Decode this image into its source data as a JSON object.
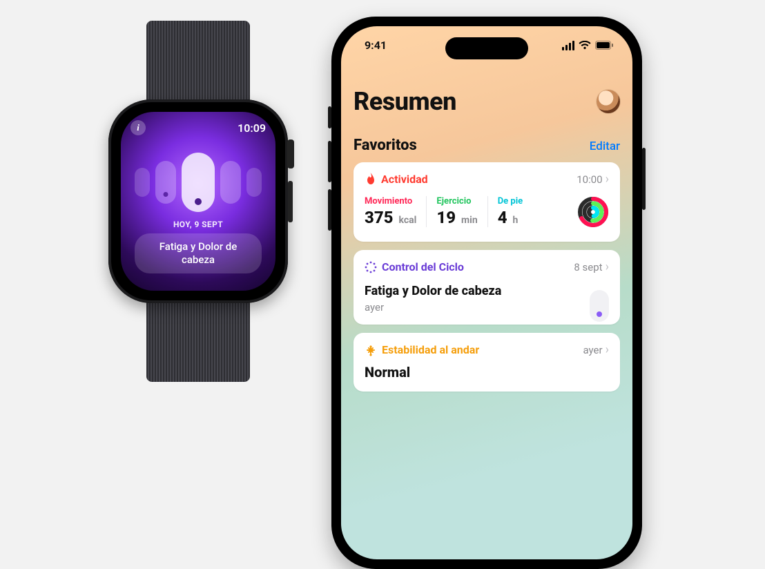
{
  "watch": {
    "time": "10:09",
    "info_glyph": "i",
    "date_label": "HOY, 9 SEPT",
    "symptom_pill": "Fatiga y Dolor de cabeza"
  },
  "phone": {
    "status_time": "9:41",
    "page_title": "Resumen",
    "favorites_label": "Favoritos",
    "edit_label": "Editar",
    "activity": {
      "title": "Actividad",
      "time": "10:00",
      "move_label": "Movimiento",
      "move_value": "375",
      "move_unit": "kcal",
      "exercise_label": "Ejercicio",
      "exercise_value": "19",
      "exercise_unit": "min",
      "stand_label": "De pie",
      "stand_value": "4",
      "stand_unit": "h"
    },
    "cycle": {
      "title": "Control del Ciclo",
      "date": "8 sept",
      "subtitle": "Fatiga y Dolor de cabeza",
      "sub_when": "ayer"
    },
    "stability": {
      "title": "Estabilidad al andar",
      "date": "ayer",
      "value": "Normal"
    }
  }
}
